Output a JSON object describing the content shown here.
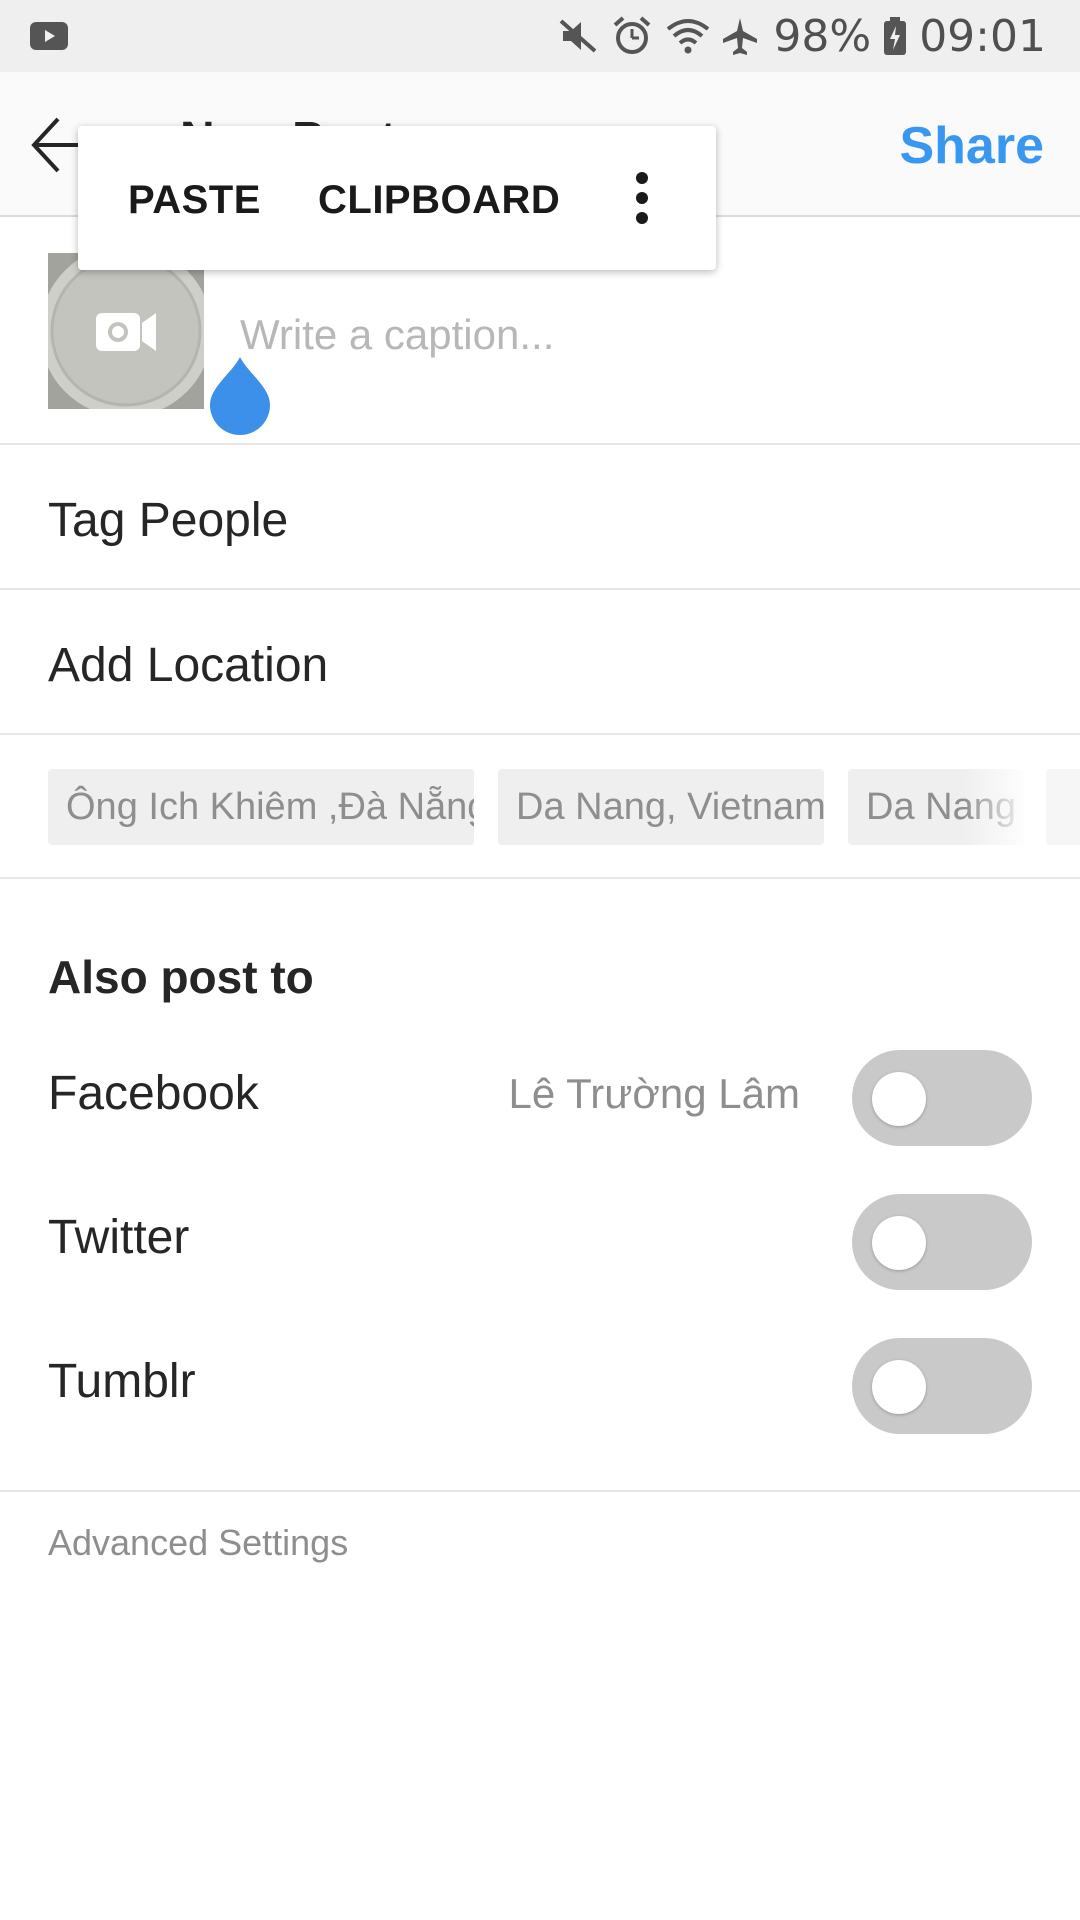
{
  "status_bar": {
    "battery": "98%",
    "time": "09:01",
    "icons": [
      "youtube-icon",
      "mute-icon",
      "alarm-icon",
      "wifi-icon",
      "airplane-icon",
      "battery-charging-icon"
    ]
  },
  "header": {
    "title": "New Post",
    "share_label": "Share"
  },
  "context_menu": {
    "paste_label": "PASTE",
    "clipboard_label": "CLIPBOARD"
  },
  "caption": {
    "placeholder": "Write a caption..."
  },
  "rows": {
    "tag_people": "Tag People",
    "add_location": "Add Location"
  },
  "location_suggestions": [
    "Ông Ich Khiêm ,Đà Nẵng",
    "Da Nang, Vietnam",
    "Da Nang"
  ],
  "also_post_to": {
    "title": "Also post to",
    "facebook": {
      "label": "Facebook",
      "account": "Lê Trường Lâm",
      "enabled": false
    },
    "twitter": {
      "label": "Twitter",
      "enabled": false
    },
    "tumblr": {
      "label": "Tumblr",
      "enabled": false
    }
  },
  "advanced_settings": "Advanced Settings",
  "colors": {
    "accent": "#3897f0",
    "toggle_off": "#c9c9c9",
    "muted_text": "#8e8e8e"
  }
}
